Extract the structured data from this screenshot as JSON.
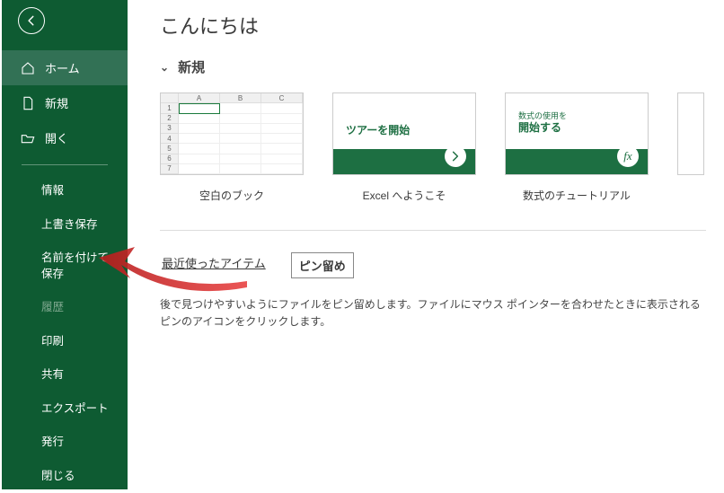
{
  "page_title": "こんにちは",
  "sidebar": {
    "main": [
      {
        "label": "ホーム",
        "icon": "home-icon"
      },
      {
        "label": "新規",
        "icon": "document-icon"
      },
      {
        "label": "開く",
        "icon": "folder-open-icon"
      }
    ],
    "sub": [
      {
        "label": "情報"
      },
      {
        "label": "上書き保存"
      },
      {
        "label": "名前を付けて保存"
      },
      {
        "label": "履歴",
        "disabled": true
      },
      {
        "label": "印刷"
      },
      {
        "label": "共有"
      },
      {
        "label": "エクスポート"
      },
      {
        "label": "発行"
      },
      {
        "label": "閉じる"
      }
    ]
  },
  "section_new": {
    "heading": "新規",
    "templates": [
      {
        "caption": "空白のブック"
      },
      {
        "caption": "Excel へようこそ",
        "overlay": "ツアーを開始"
      },
      {
        "caption": "数式のチュートリアル",
        "line1": "数式の使用を",
        "line2": "開始する",
        "fx": "fx"
      }
    ]
  },
  "recent": {
    "tabs": [
      {
        "label": "最近使ったアイテム"
      },
      {
        "label": "ピン留め",
        "selected": true
      }
    ],
    "pinned_message": "後で見つけやすいようにファイルをピン留めします。ファイルにマウス ポインターを合わせたときに表示されるピンのアイコンをクリックします。"
  }
}
